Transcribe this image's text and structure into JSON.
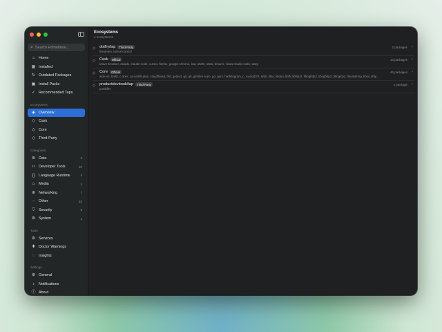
{
  "sidebar": {
    "search_placeholder": "Search Homebrew...",
    "main_items": [
      {
        "label": "Home",
        "icon": "home-icon",
        "glyph": "⌂"
      },
      {
        "label": "Installed",
        "icon": "grid-icon",
        "glyph": "▦"
      },
      {
        "label": "Outdated Packages",
        "icon": "refresh-icon",
        "glyph": "↻"
      },
      {
        "label": "Install Packs",
        "icon": "box-icon",
        "glyph": "▣"
      },
      {
        "label": "Recommended Taps",
        "icon": "check-icon",
        "glyph": "✓"
      }
    ],
    "ecosystems_label": "Ecosystems",
    "ecosystems": [
      {
        "label": "Overview",
        "icon": "cube-icon",
        "glyph": "◈",
        "active": true
      },
      {
        "label": "Cask",
        "icon": "cube-outline-icon",
        "glyph": "◇"
      },
      {
        "label": "Core",
        "icon": "cube-outline-icon",
        "glyph": "◇"
      },
      {
        "label": "Third-Party",
        "icon": "cube-outline-icon",
        "glyph": "◇"
      }
    ],
    "categories_label": "Categories",
    "categories": [
      {
        "label": "Data",
        "count": "2",
        "icon": "database-icon",
        "glyph": "≣"
      },
      {
        "label": "Developer Tools",
        "count": "10",
        "icon": "code-icon",
        "glyph": "‹›"
      },
      {
        "label": "Language Runtime",
        "count": "4",
        "icon": "braces-icon",
        "glyph": "{}"
      },
      {
        "label": "Media",
        "count": "1",
        "icon": "media-icon",
        "glyph": "▭"
      },
      {
        "label": "Networking",
        "count": "7",
        "icon": "globe-icon",
        "glyph": "⊕"
      },
      {
        "label": "Other",
        "count": "33",
        "icon": "ellipsis-icon",
        "glyph": "···"
      },
      {
        "label": "Security",
        "count": "5",
        "icon": "shield-icon",
        "glyph": "⛉"
      },
      {
        "label": "System",
        "count": "1",
        "icon": "gear-icon",
        "glyph": "⚙"
      }
    ],
    "tools_label": "Tools",
    "tools": [
      {
        "label": "Services",
        "icon": "services-icon",
        "glyph": "⚙"
      },
      {
        "label": "Doctor Warnings",
        "icon": "stethoscope-icon",
        "glyph": "✚"
      },
      {
        "label": "Insights",
        "icon": "lightbulb-icon",
        "glyph": "◌"
      }
    ],
    "settings_label": "Settings",
    "settings": [
      {
        "label": "General",
        "icon": "gear-icon",
        "glyph": "⚙"
      },
      {
        "label": "Notifications",
        "icon": "bell-icon",
        "glyph": "♪"
      },
      {
        "label": "About",
        "icon": "info-icon",
        "glyph": "ⓘ"
      }
    ]
  },
  "main": {
    "title": "Ecosystems",
    "subtitle": "4 ecosystems",
    "rows": [
      {
        "name": "dotfry/tap",
        "badge": "Third-Party",
        "desc": "lineamen, lumus-control",
        "packages": "2 packages"
      },
      {
        "name": "Cask",
        "badge": "Official",
        "desc": "brave-browser, claude, claude-code, cursor, firefox, google-chrome, iina, obsht, stats, tenurin, visual-studio-code, warp",
        "packages": "13 packages"
      },
      {
        "name": "Core",
        "badge": "Official",
        "desc": "aide-vrt, bmth, c-ares, ca-certificates, cloudflared, fmt, gettext, git, gh, git-filter-repo, go, gum, harfnlogram_c, icu4c@78, krb5, libiu, libdun, libffi, libfido2, libnghttp2, libnghttp3, libngtcp2, libunistring, libuv, libtp...",
        "packages": "46 packages"
      },
      {
        "name": "productdevbook/tap",
        "badge": "Third-Party",
        "desc": "portkiller",
        "packages": "1 package"
      }
    ]
  }
}
